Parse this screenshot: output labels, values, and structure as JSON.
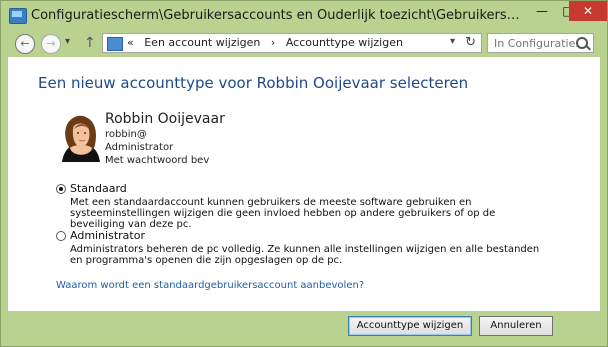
{
  "window": {
    "title": "Configuratiescherm\\Gebruikersaccounts en Ouderlijk toezicht\\Gebruikersaccounts\\Ac...",
    "minimize_icon": "—",
    "maximize_icon": "□",
    "close_icon": "✕"
  },
  "nav": {
    "back_icon": "←",
    "forward_icon": "→",
    "recent_icon": "▾",
    "up_icon": "↑",
    "breadcrumb_separator": "«",
    "breadcrumbs": [
      "Een account wijzigen",
      "Accounttype wijzigen"
    ],
    "dropdown_icon": "▾",
    "refresh_icon": "↻",
    "search_placeholder": "In Configuratie..."
  },
  "page": {
    "title": "Een nieuw accounttype voor Robbin Ooijevaar selecteren"
  },
  "user": {
    "name": "Robbin Ooijevaar",
    "email": "robbin@",
    "role": "Administrator",
    "password_status": "Met wachtwoord bev"
  },
  "options": {
    "standard": {
      "label": "Standaard",
      "description": "Met een standaardaccount kunnen gebruikers de meeste software gebruiken en systeeminstellingen wijzigen die geen invloed hebben op andere gebruikers of op de beveiliging van deze pc."
    },
    "administrator": {
      "label": "Administrator",
      "description": "Administrators beheren de pc volledig. Ze kunnen alle instellingen wijzigen en alle bestanden en programma's openen die zijn opgeslagen op de pc."
    }
  },
  "links": {
    "recommendation": "Waarom wordt een standaardgebruikersaccount aanbevolen?"
  },
  "buttons": {
    "change_type": "Accounttype wijzigen",
    "cancel": "Annuleren"
  },
  "colors": {
    "accent_title": "#1f4a8a",
    "link": "#205ea8",
    "close_red": "#c7392f",
    "chrome_green": "#b9d28f"
  }
}
